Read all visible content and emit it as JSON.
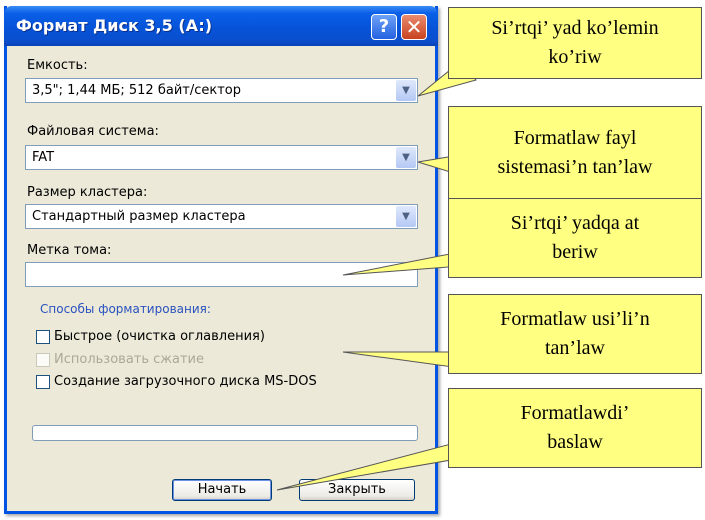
{
  "dialog": {
    "title": "Формат Диск 3,5 (A:)",
    "help_button": "?",
    "close_button": "✕",
    "capacity": {
      "label": "Емкость:",
      "value": "3,5\"; 1,44 МБ; 512 байт/сектор"
    },
    "file_system": {
      "label": "Файловая система:",
      "value": "FAT"
    },
    "cluster_size": {
      "label": "Размер кластера:",
      "value": "Стандартный размер кластера"
    },
    "volume_label": {
      "label": "Метка тома:",
      "value": ""
    },
    "format_options": {
      "title": "Способы форматирования:",
      "quick_format": "Быстрое (очистка оглавления)",
      "enable_compression": "Использовать сжатие",
      "create_msdos_disk": "Создание загрузочного диска MS-DOS"
    },
    "progress": 0,
    "start_button": "Начать",
    "close_dialog_button": "Закрыть"
  },
  "callouts": [
    {
      "line1": "Si’rtqi’ yad ko’lemin",
      "line2": "ko’riw"
    },
    {
      "line1": "Formatlaw fayl",
      "line2": "sistemasi’n tan’law"
    },
    {
      "line1": "Si’rtqi’ yadqa at",
      "line2": "beriw"
    },
    {
      "line1": "Formatlaw usi’li’n",
      "line2": "tan’law"
    },
    {
      "line1": "Formatlawdi’",
      "line2": "baslaw"
    }
  ],
  "colors": {
    "callout_fill": "#ffff82",
    "titlebar": "#0653d8",
    "dialog_face": "#ece9d8",
    "group_title": "#2a52be"
  }
}
